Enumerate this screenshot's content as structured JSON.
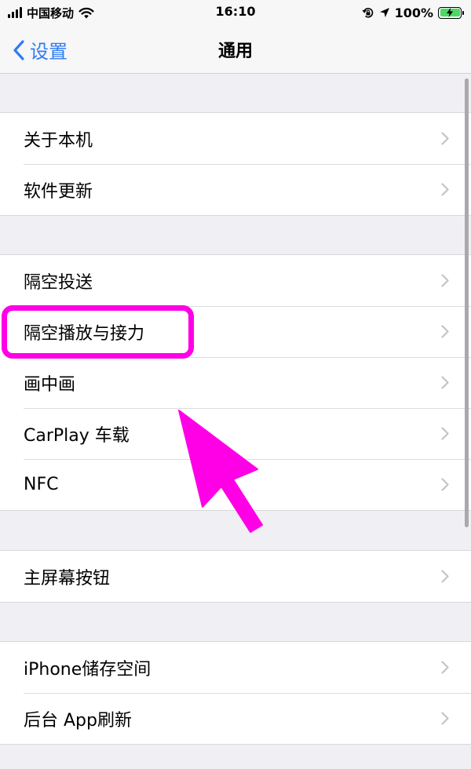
{
  "status_bar": {
    "carrier": "中国移动",
    "time": "16:10",
    "battery_percent": "100%",
    "icons": [
      "signal-bars-icon",
      "wifi-icon",
      "orientation-lock-icon",
      "location-arrow-icon",
      "battery-charging-icon"
    ]
  },
  "nav": {
    "back_label": "设置",
    "title": "通用"
  },
  "groups": [
    {
      "items": [
        {
          "label": "关于本机"
        },
        {
          "label": "软件更新"
        }
      ]
    },
    {
      "items": [
        {
          "label": "隔空投送"
        },
        {
          "label": "隔空播放与接力"
        },
        {
          "label": "画中画"
        },
        {
          "label": "CarPlay 车载"
        },
        {
          "label": "NFC"
        }
      ]
    },
    {
      "items": [
        {
          "label": "主屏幕按钮"
        }
      ]
    },
    {
      "items": [
        {
          "label": "iPhone储存空间"
        },
        {
          "label": "后台 App刷新"
        }
      ]
    }
  ],
  "colors": {
    "accent": "#2f7cf6",
    "annotation": "#ff00e6",
    "battery": "#4cd964"
  }
}
